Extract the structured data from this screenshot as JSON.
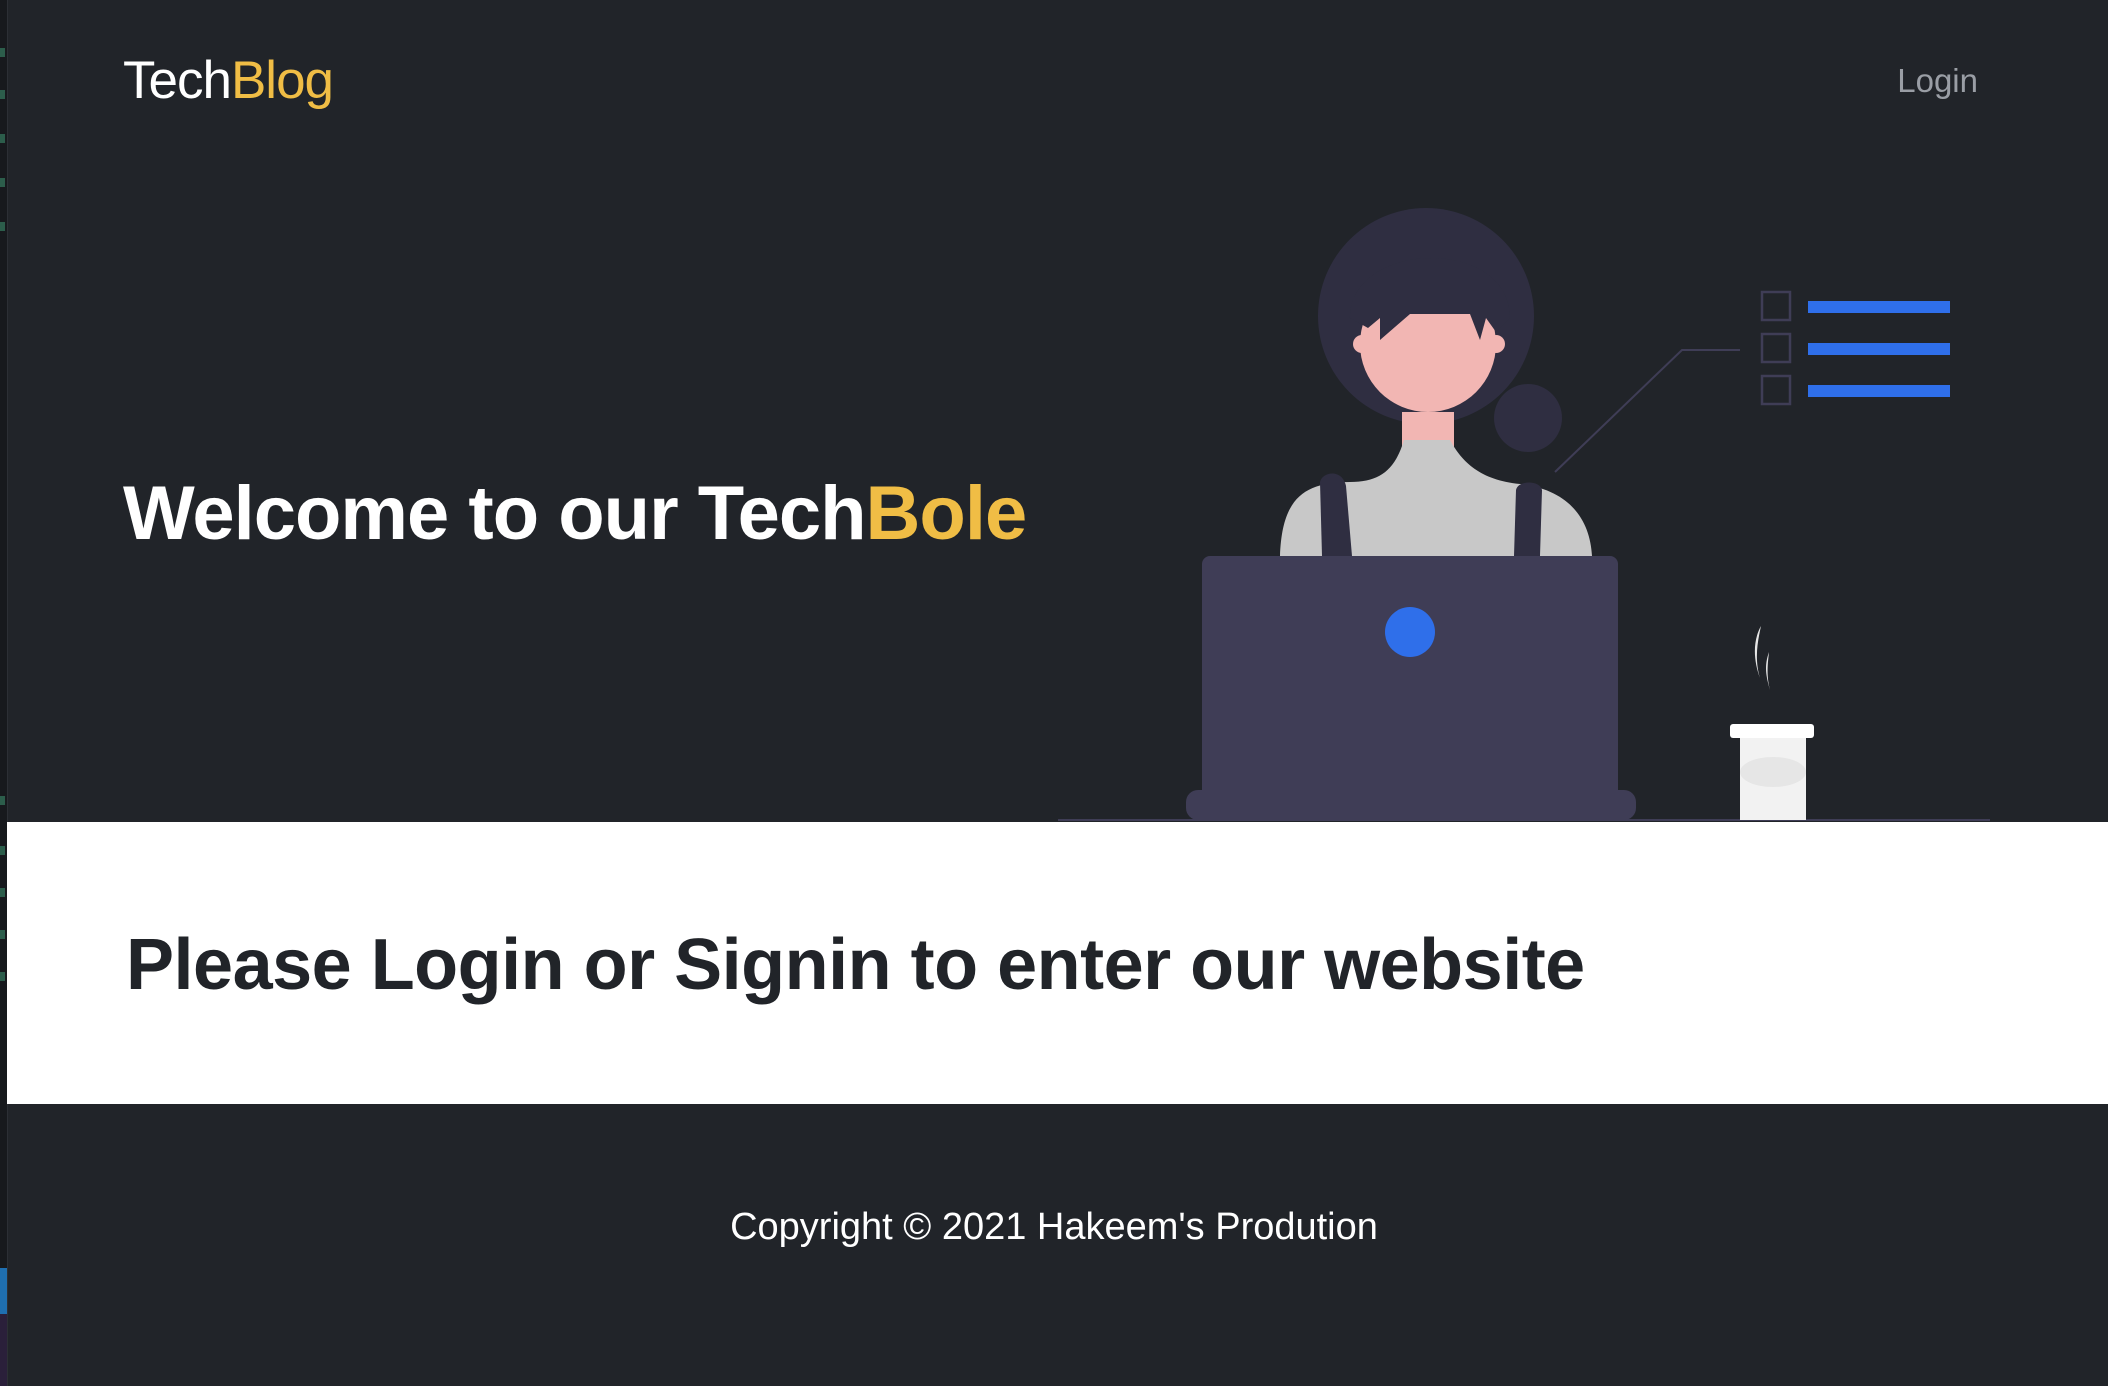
{
  "header": {
    "brand_part1": "Tech",
    "brand_part2": "Blog",
    "login_label": "Login"
  },
  "hero": {
    "title_part1": "Welcome to our Tech",
    "title_part2": "Bole",
    "illustration_icon": "woman-at-laptop-illustration"
  },
  "cta": {
    "text": "Please Login or Signin to enter our website"
  },
  "footer": {
    "copyright": "Copyright © 2021 Hakeem's Prodution"
  },
  "colors": {
    "background": "#212429",
    "accent": "#f0bd45",
    "illustration_blue": "#2f6fea",
    "band": "#ffffff"
  }
}
